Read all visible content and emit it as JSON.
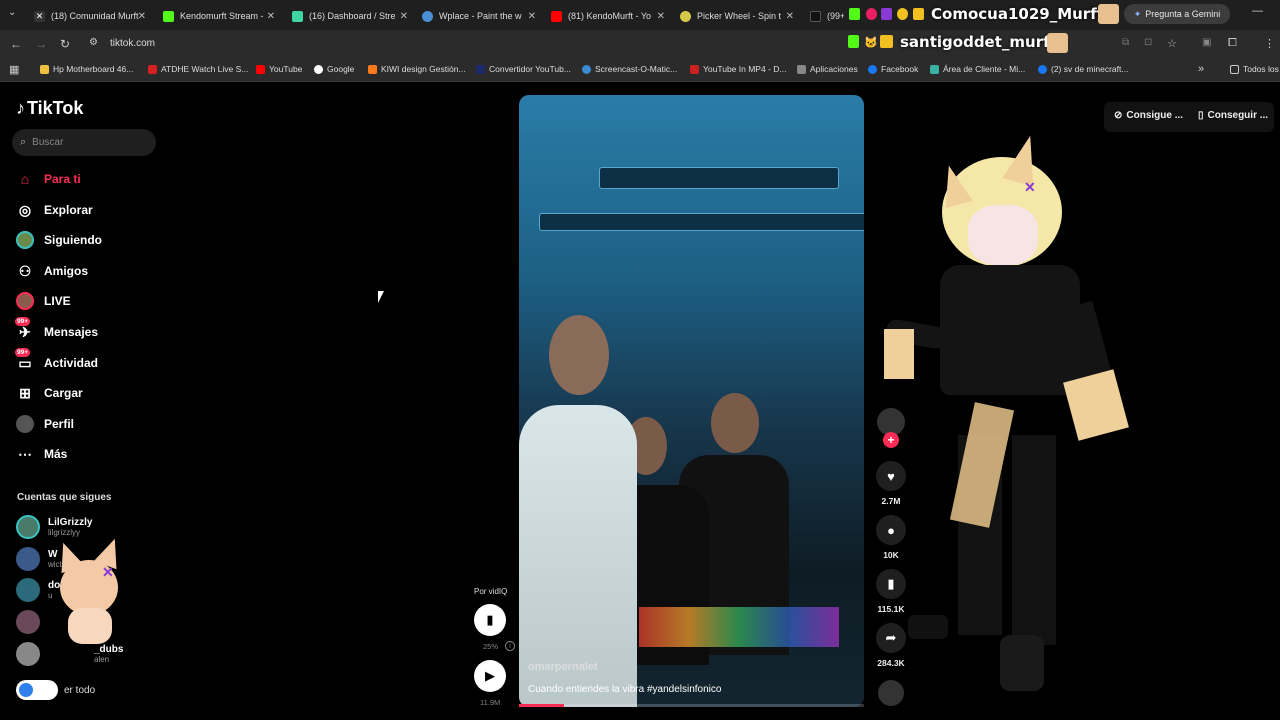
{
  "browser": {
    "tabs": [
      {
        "label": "(18) Comunidad Murft",
        "color": "#aaaaaa"
      },
      {
        "label": "Kendomurft Stream -",
        "color": "#53fc18"
      },
      {
        "label": "(16) Dashboard / Stre",
        "color": "#3fd4a4"
      },
      {
        "label": "Wplace - Paint the w",
        "color": "#4a8fd4"
      },
      {
        "label": "(81) KendoMurft - Yo",
        "color": "#ff0000"
      },
      {
        "label": "Picker Wheel - Spin t",
        "color": "#d4c94a"
      },
      {
        "label": "(99+",
        "color": "#e91e63"
      }
    ],
    "overlay_name_1": "Comocua1029_Murft :",
    "overlay_name_2": "santigoddet_murft :",
    "gemini": "Pregunta a Gemini",
    "url": "tiktok.com",
    "bookmarks": [
      {
        "label": "Hp Motherboard 46...",
        "color": "#f0c040"
      },
      {
        "label": "ATDHE Watch Live S...",
        "color": "#d42020"
      },
      {
        "label": "YouTube",
        "color": "#ff0000"
      },
      {
        "label": "Google",
        "color": "#ffffff"
      },
      {
        "label": "KIWI design Gestión...",
        "color": "#ff7a1a"
      },
      {
        "label": "Convertidor YouTub...",
        "color": "#1a2a6a"
      },
      {
        "label": "Screencast-O-Matic...",
        "color": "#3a8ad4"
      },
      {
        "label": "YouTube In MP4 - D...",
        "color": "#cc1f1f"
      },
      {
        "label": "Aplicaciones",
        "color": "#888888"
      },
      {
        "label": "Facebook",
        "color": "#1877f2"
      },
      {
        "label": "Área de Cliente - Mi...",
        "color": "#3ab0a0"
      },
      {
        "label": "(2) sv de minecraft...",
        "color": "#1877f2"
      },
      {
        "label": "Todos los",
        "color": "#888888"
      }
    ]
  },
  "sidebar": {
    "logo": "TikTok",
    "search_placeholder": "Buscar",
    "nav": [
      {
        "label": "Para ti"
      },
      {
        "label": "Explorar"
      },
      {
        "label": "Siguiendo"
      },
      {
        "label": "Amigos"
      },
      {
        "label": "LIVE"
      },
      {
        "label": "Mensajes",
        "badge": "99+"
      },
      {
        "label": "Actividad",
        "badge": "99+"
      },
      {
        "label": "Cargar"
      },
      {
        "label": "Perfil"
      },
      {
        "label": "Más"
      }
    ],
    "following_title": "Cuentas que sigues",
    "accounts": [
      {
        "name": "LilGrizzly",
        "handle": "lilgrizzlyy"
      },
      {
        "name": "W",
        "handle": "wict"
      },
      {
        "name": "do",
        "handle": "u"
      },
      {
        "name": "",
        "handle": ""
      },
      {
        "name": "_dubs",
        "handle": "alen"
      }
    ],
    "see_all": "er todo"
  },
  "video": {
    "username": "omarpernalet",
    "caption": "Cuando entiendes la vibra #yandelsinfonico",
    "progress": 0.13
  },
  "vidiq": {
    "label": "Por vidIQ",
    "percent": "25%",
    "views": "11.9M"
  },
  "actions": [
    {
      "icon": "heart",
      "count": "2.7M"
    },
    {
      "icon": "comment",
      "count": "10K"
    },
    {
      "icon": "bookmark",
      "count": "115.1K"
    },
    {
      "icon": "share",
      "count": "284.3K"
    }
  ],
  "top_links": {
    "get_app": "Consigue ...",
    "get_desktop": "Conseguir ..."
  }
}
